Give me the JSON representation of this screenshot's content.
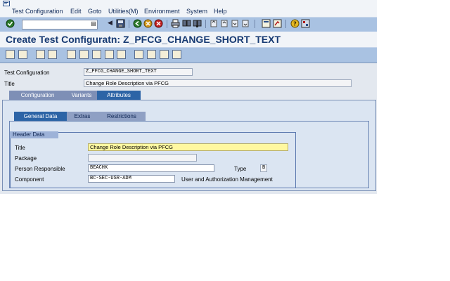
{
  "menubar": {
    "items": [
      {
        "label": "Test Configuration",
        "ul": "T"
      },
      {
        "label": "Edit",
        "ul": "E"
      },
      {
        "label": "Goto",
        "ul": "G"
      },
      {
        "label": "Utilities(M)",
        "ul": "U"
      },
      {
        "label": "Environment",
        "ul": "n"
      },
      {
        "label": "System",
        "ul": "S"
      },
      {
        "label": "Help",
        "ul": "H"
      }
    ]
  },
  "header": {
    "title": "Create Test Configuratn: Z_PFCG_CHANGE_SHORT_TEXT"
  },
  "top_fields": {
    "test_configuration_label": "Test Configuration",
    "test_configuration_value": "Z_PFCG_CHANGE_SHORT_TEXT",
    "title_label": "Title",
    "title_value": "Change Role Description via PFCG"
  },
  "main_tabs": [
    {
      "label": "Configuration",
      "active": false
    },
    {
      "label": "Variants",
      "active": false
    },
    {
      "label": "Attributes",
      "active": true
    }
  ],
  "sub_tabs": [
    {
      "label": "General Data",
      "active": true
    },
    {
      "label": "Extras",
      "active": false
    },
    {
      "label": "Restrictions",
      "active": false
    }
  ],
  "header_data": {
    "group_title": "Header Data",
    "title_label": "Title",
    "title_value": "Change Role Description via PFCG",
    "package_label": "Package",
    "package_value": "",
    "person_label": "Person Responsible",
    "person_value": "BEACHK",
    "type_label": "Type",
    "type_value": "B",
    "component_label": "Component",
    "component_value": "BC-SEC-USR-ADM",
    "component_desc": "User and Authorization Management"
  },
  "colors": {
    "toolbar": "#a9c2e2",
    "title": "#173a72",
    "tab_active": "#2c64a6",
    "required_field": "#fff8a0"
  }
}
